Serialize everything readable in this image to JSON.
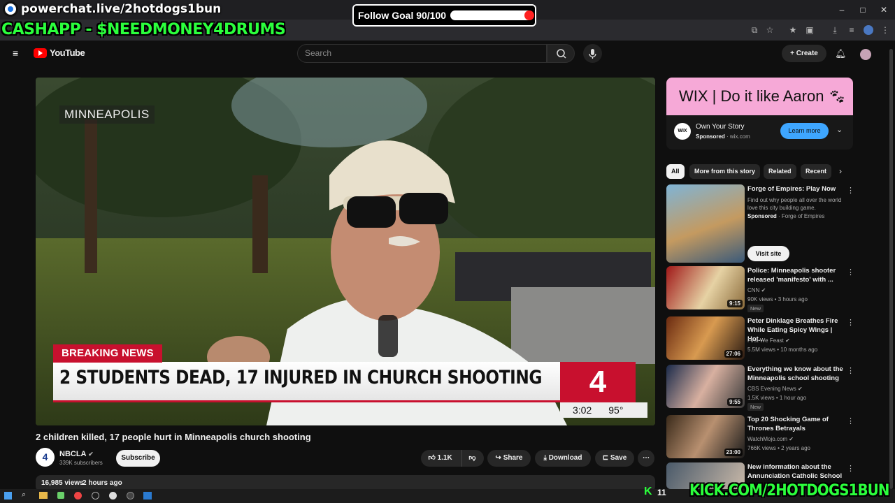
{
  "overlay": {
    "stream_title": "powerchat.live/2hotdogs1bun",
    "cashapp": "CASHAPP - $NEEDMONEY4DRUMS",
    "goal_label": "Follow Goal 90/100",
    "goal_progress": 0.9,
    "kick_url": "KICK.COM/2HOTDOGS1BUN",
    "viewer_count": "11"
  },
  "header": {
    "logo_text": "YouTube",
    "search_placeholder": "Search",
    "create_label": "Create"
  },
  "video": {
    "location_tag": "MINNEAPOLIS",
    "breaking_label": "BREAKING NEWS",
    "headline": "2 STUDENTS DEAD, 17 INJURED IN CHURCH SHOOTING",
    "station_logo": "4",
    "time": "3:02",
    "temp": "95°",
    "title": "2 children killed, 17 people hurt in Minneapolis church shooting",
    "channel": "NBCLA",
    "subscribers": "339K subscribers",
    "subscribe_label": "Subscribe",
    "likes": "1.1K",
    "share_label": "Share",
    "download_label": "Download",
    "save_label": "Save",
    "views": "16,985 views",
    "posted": "2 hours ago"
  },
  "ad": {
    "banner": "WIX | Do it like Aaron",
    "title": "Own Your Story",
    "sponsored": "Sponsored",
    "domain": "wix.com",
    "cta": "Learn more"
  },
  "chips": [
    "All",
    "More from this story",
    "Related",
    "Recent"
  ],
  "recs": [
    {
      "title": "Forge of Empires: Play Now",
      "desc": "Find out why people all over the world love this city building game.",
      "sponsored": "Sponsored",
      "channel": "Forge of Empires",
      "cta": "Visit site"
    },
    {
      "title": "Police: Minneapolis shooter released 'manifesto' with ...",
      "channel": "CNN",
      "meta": "90K views • 3 hours ago",
      "badge": "New",
      "duration": "9:15"
    },
    {
      "title": "Peter Dinklage Breathes Fire While Eating Spicy Wings | Hot...",
      "channel": "First We Feast",
      "meta": "5.5M views • 10 months ago",
      "duration": "27:06"
    },
    {
      "title": "Everything we know about the Minneapolis school shooting",
      "channel": "CBS Evening News",
      "meta": "1.5K views • 1 hour ago",
      "badge": "New",
      "duration": "9:55"
    },
    {
      "title": "Top 20 Shocking Game of Thrones Betrayals",
      "channel": "WatchMojo.com",
      "meta": "766K views • 2 years ago",
      "duration": "23:00"
    },
    {
      "title": "New information about the Annunciation Catholic School ..."
    }
  ]
}
